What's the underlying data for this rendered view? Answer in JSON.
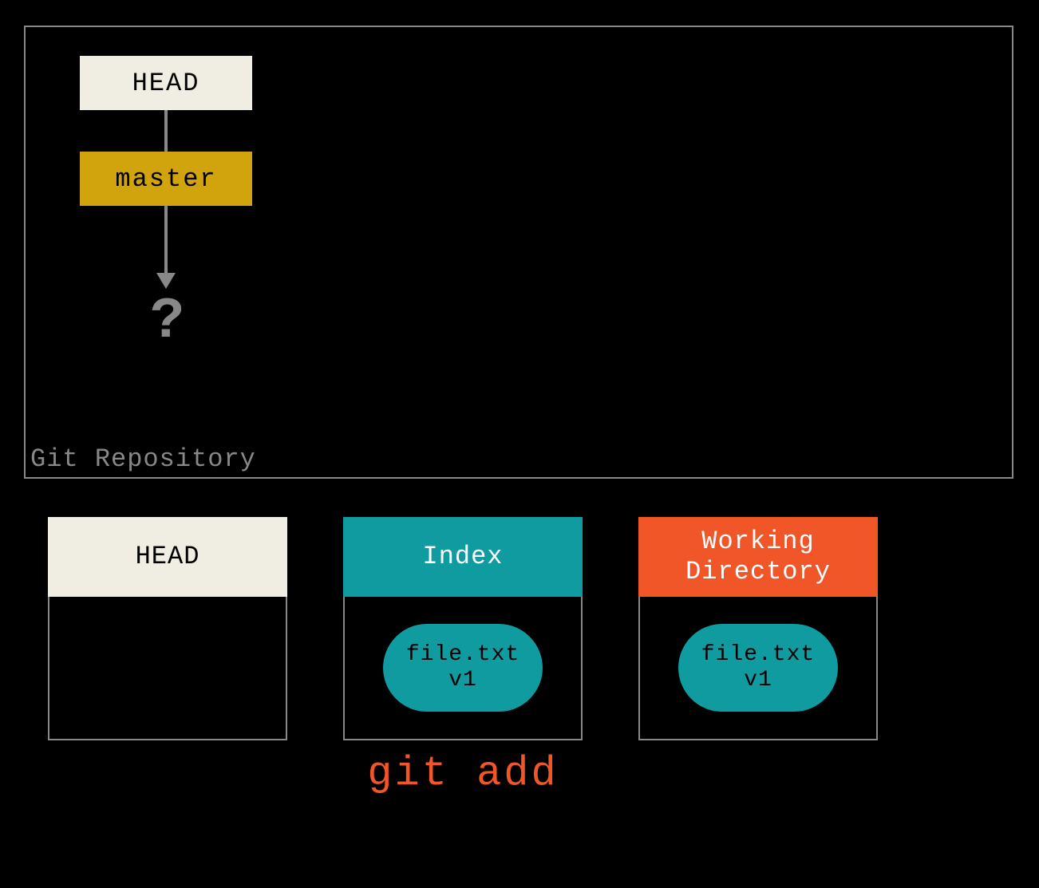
{
  "repo": {
    "label": "Git Repository",
    "head": "HEAD",
    "branch": "master",
    "unknown": "?"
  },
  "columns": {
    "head": "HEAD",
    "index": "Index",
    "wd_line1": "Working",
    "wd_line2": "Directory"
  },
  "file": {
    "name": "file.txt",
    "version": "v1"
  },
  "command": "git add"
}
